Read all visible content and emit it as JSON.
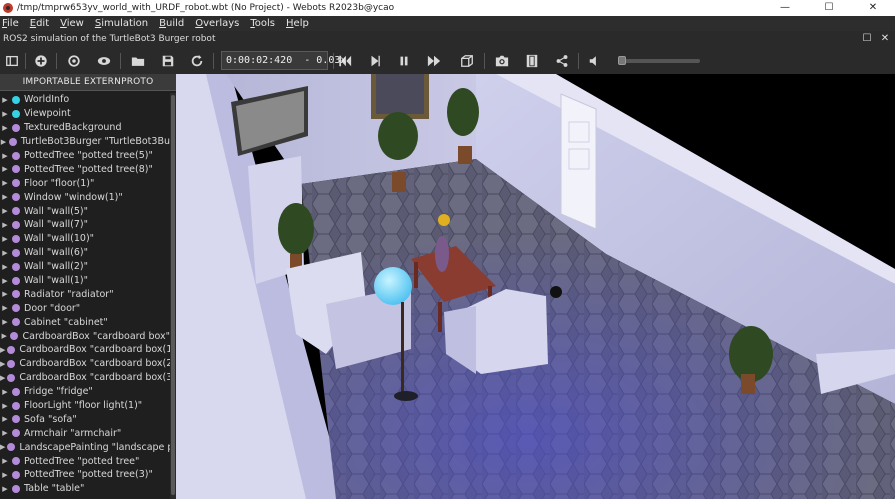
{
  "window": {
    "title": "/tmp/tmprw653yv_world_with_URDF_robot.wbt (No Project) - Webots R2023b@ycao",
    "minimize_glyph": "—",
    "maximize_glyph": "☐",
    "close_glyph": "✕"
  },
  "menu": [
    "File",
    "Edit",
    "View",
    "Simulation",
    "Build",
    "Overlays",
    "Tools",
    "Help"
  ],
  "subtitle": "ROS2 simulation of the TurtleBot3 Burger robot",
  "subtitle_controls": {
    "restore_glyph": "☐",
    "close_glyph": "✕"
  },
  "toolbar": {
    "time": "0:00:02:420",
    "speed": "-  0.03x"
  },
  "scene_tree": {
    "header": "IMPORTABLE EXTERNPROTO",
    "items": [
      {
        "label": "WorldInfo",
        "color": "cyan"
      },
      {
        "label": "Viewpoint",
        "color": "cyan"
      },
      {
        "label": "TexturedBackground",
        "color": "purple"
      },
      {
        "label": "TurtleBot3Burger \"TurtleBot3Bu",
        "color": "purple"
      },
      {
        "label": "PottedTree \"potted tree(5)\"",
        "color": "purple"
      },
      {
        "label": "PottedTree \"potted tree(8)\"",
        "color": "purple"
      },
      {
        "label": "Floor \"floor(1)\"",
        "color": "purple"
      },
      {
        "label": "Window \"window(1)\"",
        "color": "purple"
      },
      {
        "label": "Wall \"wall(5)\"",
        "color": "purple"
      },
      {
        "label": "Wall \"wall(7)\"",
        "color": "purple"
      },
      {
        "label": "Wall \"wall(10)\"",
        "color": "purple"
      },
      {
        "label": "Wall \"wall(6)\"",
        "color": "purple"
      },
      {
        "label": "Wall \"wall(2)\"",
        "color": "purple"
      },
      {
        "label": "Wall \"wall(1)\"",
        "color": "purple"
      },
      {
        "label": "Radiator \"radiator\"",
        "color": "purple"
      },
      {
        "label": "Door \"door\"",
        "color": "purple"
      },
      {
        "label": "Cabinet \"cabinet\"",
        "color": "purple"
      },
      {
        "label": "CardboardBox \"cardboard box\"",
        "color": "purple"
      },
      {
        "label": "CardboardBox \"cardboard box(1",
        "color": "purple"
      },
      {
        "label": "CardboardBox \"cardboard box(2",
        "color": "purple"
      },
      {
        "label": "CardboardBox \"cardboard box(3",
        "color": "purple"
      },
      {
        "label": "Fridge \"fridge\"",
        "color": "purple"
      },
      {
        "label": "FloorLight \"floor light(1)\"",
        "color": "purple"
      },
      {
        "label": "Sofa \"sofa\"",
        "color": "purple"
      },
      {
        "label": "Armchair \"armchair\"",
        "color": "purple"
      },
      {
        "label": "LandscapePainting \"landscape p",
        "color": "purple"
      },
      {
        "label": "PottedTree \"potted tree\"",
        "color": "purple"
      },
      {
        "label": "PottedTree \"potted tree(3)\"",
        "color": "purple"
      },
      {
        "label": "Table \"table\"",
        "color": "purple"
      }
    ]
  },
  "colors": {
    "node_cyan": "#35d2e6",
    "node_purple": "#b48bd9",
    "floor": "#5a5a72",
    "wall": "#c8c8e4"
  }
}
